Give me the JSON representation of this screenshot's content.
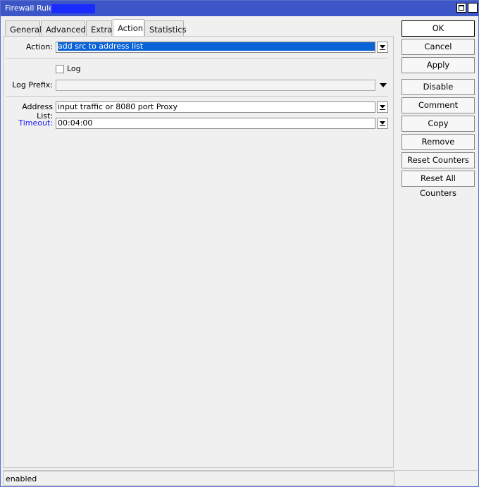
{
  "window": {
    "title": "Firewall Rule <"
  },
  "tabs": [
    {
      "label": "General"
    },
    {
      "label": "Advanced"
    },
    {
      "label": "Extra"
    },
    {
      "label": "Action"
    },
    {
      "label": "Statistics"
    }
  ],
  "active_tab": "Action",
  "form": {
    "action": {
      "label": "Action:",
      "value": "add src to address list"
    },
    "log": {
      "label": "Log",
      "checked": false
    },
    "log_prefix": {
      "label": "Log Prefix:",
      "value": ""
    },
    "address_list": {
      "label": "Address List:",
      "value": "input traffic or 8080 port Proxy"
    },
    "timeout": {
      "label": "Timeout:",
      "value": "00:04:00",
      "color": "#1a1aff"
    }
  },
  "buttons": {
    "ok": "OK",
    "cancel": "Cancel",
    "apply": "Apply",
    "disable": "Disable",
    "comment": "Comment",
    "copy": "Copy",
    "remove": "Remove",
    "reset_counters": "Reset Counters",
    "reset_all_counters": "Reset All Counters"
  },
  "status": {
    "text": "enabled"
  },
  "colors": {
    "titlebar": "#3c56c7",
    "selection": "#0a64d8"
  }
}
